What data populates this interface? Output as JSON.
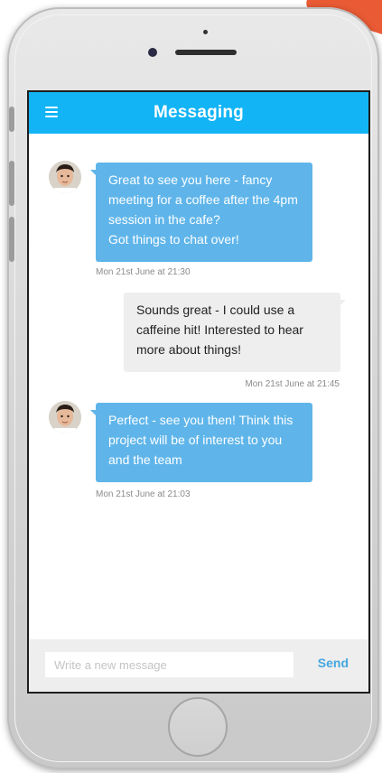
{
  "app": {
    "title": "Messaging",
    "accent_color": "#12b4f5",
    "menu_icon": "hamburger-menu-icon"
  },
  "messages": [
    {
      "direction": "incoming",
      "text": "Great to see you here - fancy meeting for a coffee after the 4pm session in the cafe?\nGot things to chat over!",
      "timestamp": "Mon 21st June at 21:30",
      "avatar": "user-avatar"
    },
    {
      "direction": "outgoing",
      "text": "Sounds great - I could use a caffeine hit! Interested to hear more about things!",
      "timestamp": "Mon 21st June at 21:45"
    },
    {
      "direction": "incoming",
      "text": "Perfect - see you then! Think this project will be of interest to you and the team",
      "timestamp": "Mon 21st June at 21:03",
      "avatar": "user-avatar"
    }
  ],
  "composer": {
    "placeholder": "Write a new message",
    "value": "",
    "send_label": "Send"
  },
  "colors": {
    "incoming_bubble": "#5fb5ea",
    "outgoing_bubble": "#eeeeee",
    "send_text": "#45a7e0",
    "background_accent": "#ea5b35"
  }
}
